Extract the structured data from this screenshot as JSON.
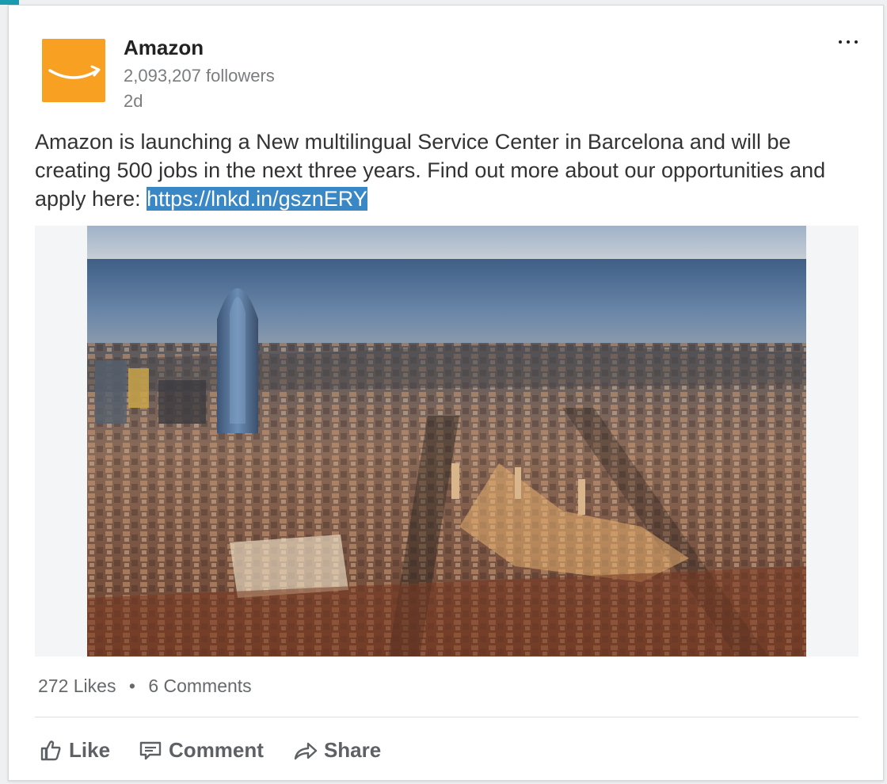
{
  "post": {
    "company": "Amazon",
    "followers": "2,093,207 followers",
    "age": "2d",
    "text_before_link": "Amazon is launching a New multilingual Service Center in Barcelona and will be creating 500 jobs in the next three years. Find out more about our opportunities and apply here: ",
    "link_text": "https://lnkd.in/gsznERY",
    "image_subject": "Aerial view of Barcelona with Torre Agbar and the Mediterranean Sea"
  },
  "stats": {
    "likes": "272 Likes",
    "separator": "•",
    "comments": "6 Comments"
  },
  "actions": {
    "like": "Like",
    "comment": "Comment",
    "share": "Share"
  },
  "icons": {
    "menu": "more-options-icon",
    "like": "thumbs-up-icon",
    "comment": "comment-icon",
    "share": "share-arrow-icon"
  },
  "colors": {
    "brand": "#f7a022",
    "link_highlight": "#3a87c6",
    "text": "#333333",
    "muted": "#7a7d80"
  }
}
